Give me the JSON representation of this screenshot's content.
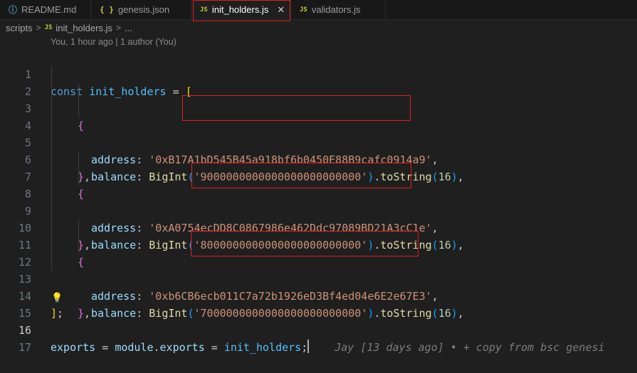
{
  "tabs": [
    {
      "label": "README.md",
      "icon": "md-file-icon",
      "glyph": "ⓘ",
      "active": false
    },
    {
      "label": "genesis.json",
      "icon": "json-file-icon",
      "glyph": "{ }",
      "active": false
    },
    {
      "label": "init_holders.js",
      "icon": "js-file-icon",
      "glyph": "JS",
      "active": true
    },
    {
      "label": "validators.js",
      "icon": "js-file-icon",
      "glyph": "JS",
      "active": false
    }
  ],
  "tab_close_glyph": "✕",
  "breadcrumb": {
    "folder": "scripts",
    "sep": ">",
    "file_glyph": "JS",
    "file": "init_holders.js",
    "ellipsis": "..."
  },
  "blame_header": "You, 1 hour ago | 1 author (You)",
  "code": {
    "line_numbers": [
      "1",
      "2",
      "3",
      "4",
      "5",
      "6",
      "7",
      "8",
      "9",
      "10",
      "11",
      "12",
      "13",
      "14",
      "15",
      "16",
      "17"
    ],
    "current_line": "16",
    "holders": [
      {
        "address": "'0xB17A1bD545B45a918bf6b0450E88B9cafc0914a9'",
        "balance": "'9000000000000000000000000'"
      },
      {
        "address": "'0xA0754ecDD8C0867986e462Ddc97089BD21A3cC1e'",
        "balance": "'8000000000000000000000000'"
      },
      {
        "address": "'0xb6CB6ecb011C7a72b1926eD3Bf4ed04e6E2e67E3'",
        "balance": "'7000000000000000000000000'"
      }
    ],
    "tokens": {
      "const_kw": "const",
      "var_name": "init_holders",
      "assign": " = ",
      "open_bracket": "[",
      "close_bracket": "]",
      "semicolon": ";",
      "open_brace": "{",
      "close_brace": "}",
      "comma": ",",
      "address_key": "address",
      "balance_key": "balance",
      "colon": ": ",
      "bigint": "BigInt",
      "open_paren": "(",
      "close_paren": ")",
      "dot": ".",
      "tostring": "toString",
      "radix": "16",
      "exports": "exports",
      "module": "module",
      "exports_prop": "exports"
    },
    "inline_blame": "Jay [13 days ago] • + copy from bsc genesi",
    "lightbulb": "💡"
  }
}
